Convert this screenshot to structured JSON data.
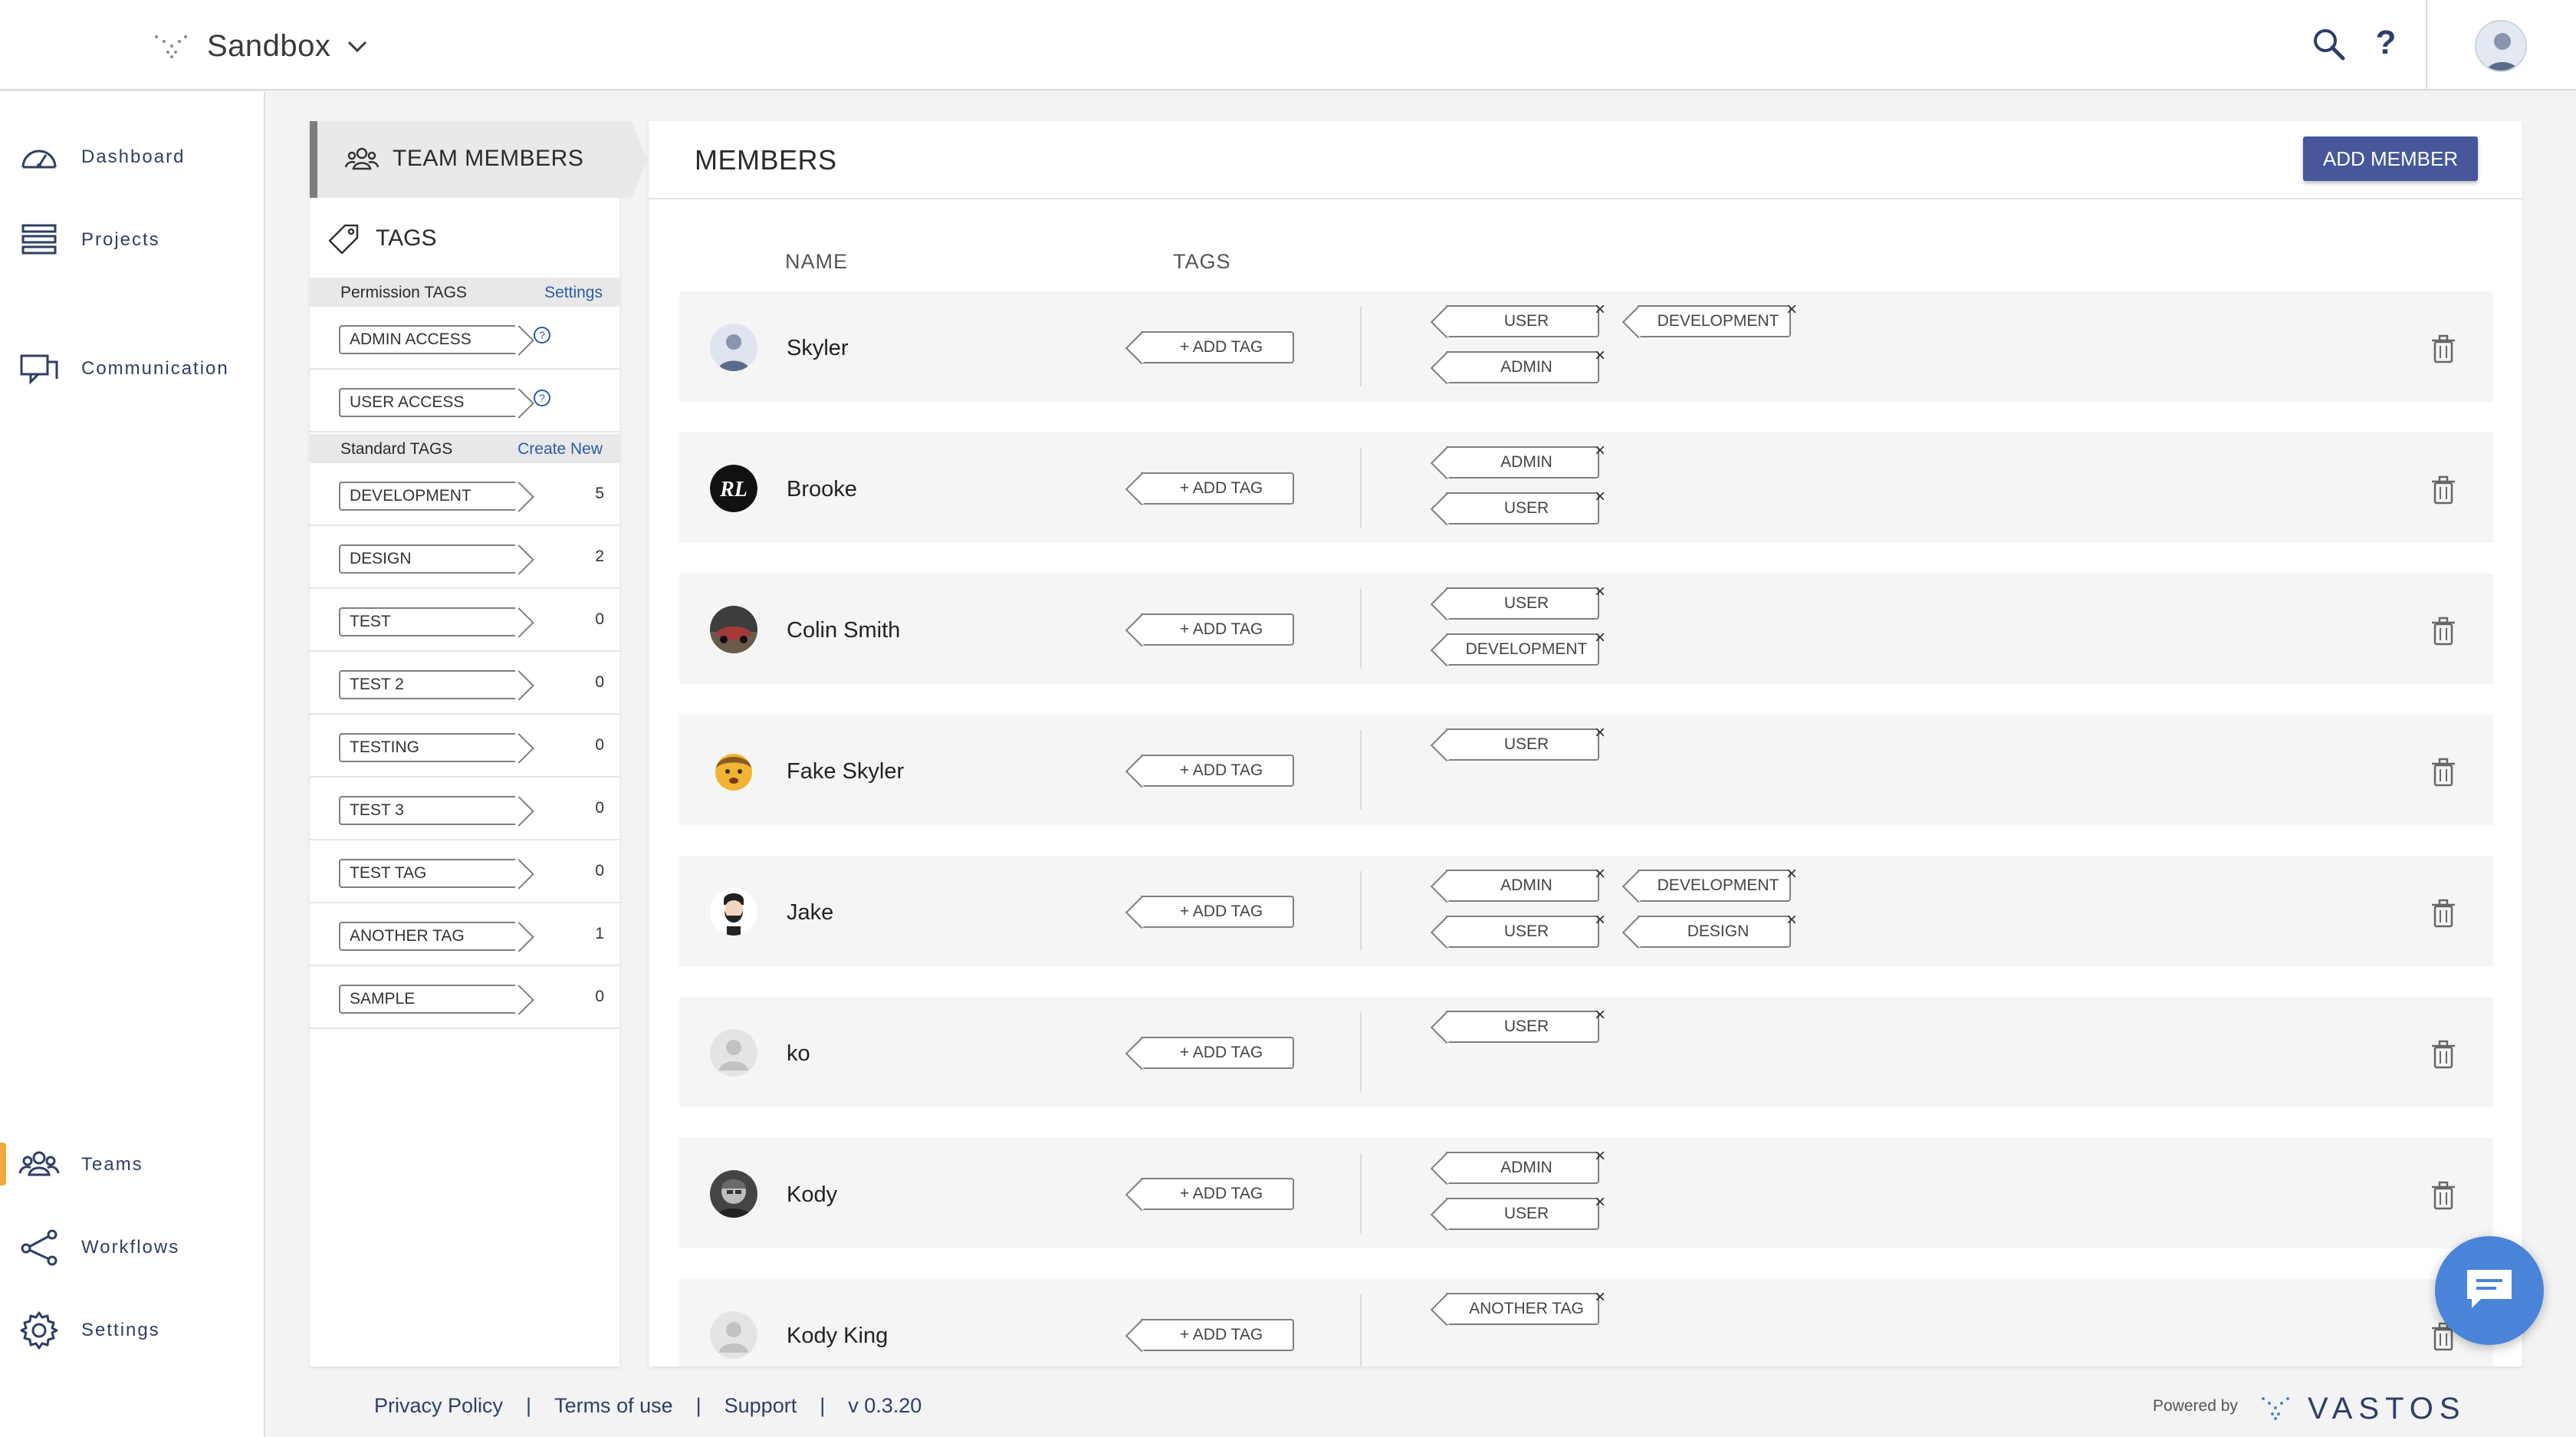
{
  "header": {
    "workspace_name": "Sandbox",
    "help_label": "?"
  },
  "sidebar": {
    "items": [
      {
        "label": "Dashboard",
        "icon": "gauge-icon"
      },
      {
        "label": "Projects",
        "icon": "list-icon"
      },
      {
        "label": "Communication",
        "icon": "chat-icon"
      },
      {
        "label": "Teams",
        "icon": "team-icon",
        "active": true
      },
      {
        "label": "Workflows",
        "icon": "share-icon"
      },
      {
        "label": "Settings",
        "icon": "gear-icon"
      }
    ]
  },
  "tags_panel": {
    "team_members_label": "TEAM MEMBERS",
    "tags_label": "TAGS",
    "permission_section": {
      "title": "Permission TAGS",
      "link": "Settings"
    },
    "permission_tags": [
      {
        "label": "ADMIN ACCESS"
      },
      {
        "label": "USER ACCESS"
      }
    ],
    "standard_section": {
      "title": "Standard TAGS",
      "link": "Create New"
    },
    "standard_tags": [
      {
        "label": "DEVELOPMENT",
        "count": "5"
      },
      {
        "label": "DESIGN",
        "count": "2"
      },
      {
        "label": "TEST",
        "count": "0"
      },
      {
        "label": "TEST 2",
        "count": "0"
      },
      {
        "label": "TESTING",
        "count": "0"
      },
      {
        "label": "TEST 3",
        "count": "0"
      },
      {
        "label": "TEST TAG",
        "count": "0"
      },
      {
        "label": "ANOTHER TAG",
        "count": "1"
      },
      {
        "label": "SAMPLE",
        "count": "0"
      }
    ]
  },
  "members_panel": {
    "title": "MEMBERS",
    "add_member_label": "ADD MEMBER",
    "col_name": "NAME",
    "col_tags": "TAGS",
    "add_tag_label": "+ ADD TAG",
    "members": [
      {
        "name": "Skyler",
        "avatar": "photo",
        "tags_col1": [
          "USER",
          "ADMIN"
        ],
        "tags_col2": [
          "DEVELOPMENT"
        ]
      },
      {
        "name": "Brooke",
        "avatar": "logo-rl",
        "tags_col1": [
          "ADMIN",
          "USER"
        ],
        "tags_col2": []
      },
      {
        "name": "Colin Smith",
        "avatar": "photo-car",
        "tags_col1": [
          "USER",
          "DEVELOPMENT"
        ],
        "tags_col2": []
      },
      {
        "name": "Fake Skyler",
        "avatar": "emoji-face",
        "tags_col1": [
          "USER"
        ],
        "tags_col2": []
      },
      {
        "name": "Jake",
        "avatar": "beard-face",
        "tags_col1": [
          "ADMIN",
          "USER"
        ],
        "tags_col2": [
          "DEVELOPMENT",
          "DESIGN"
        ]
      },
      {
        "name": "ko",
        "avatar": "placeholder",
        "tags_col1": [
          "USER"
        ],
        "tags_col2": []
      },
      {
        "name": "Kody",
        "avatar": "photo-bw",
        "tags_col1": [
          "ADMIN",
          "USER"
        ],
        "tags_col2": []
      },
      {
        "name": "Kody King",
        "avatar": "placeholder",
        "tags_col1": [
          "ANOTHER TAG"
        ],
        "tags_col2": []
      }
    ]
  },
  "footer": {
    "links": [
      "Privacy Policy",
      "Terms of use",
      "Support"
    ],
    "version": "v 0.3.20",
    "powered_by": "Powered by",
    "brand": "VASTOS"
  },
  "colors": {
    "primary": "#46589b",
    "nav_text": "#2f3e63",
    "active_indicator": "#f1a93b",
    "chat_fab": "#4a84d8",
    "link": "#2f5aa8"
  }
}
